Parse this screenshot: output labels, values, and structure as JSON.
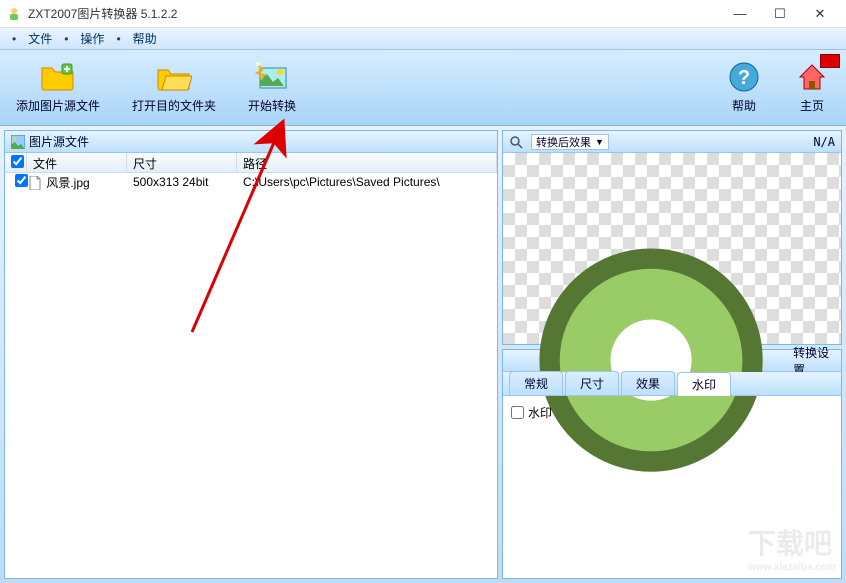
{
  "window": {
    "title": "ZXT2007图片转换器 5.1.2.2"
  },
  "menu": {
    "file": "文件",
    "operate": "操作",
    "help": "帮助"
  },
  "toolbar": {
    "add_source": "添加图片源文件",
    "open_dest": "打开目的文件夹",
    "start_convert": "开始转换",
    "help": "帮助",
    "home": "主页"
  },
  "source_panel": {
    "title": "图片源文件",
    "columns": {
      "file": "文件",
      "size": "尺寸",
      "path": "路径"
    },
    "rows": [
      {
        "checked": true,
        "name": "风景.jpg",
        "size": "500x313  24bit",
        "path": "C:\\Users\\pc\\Pictures\\Saved Pictures\\"
      }
    ]
  },
  "preview_panel": {
    "title": "转换后效果",
    "status": "N/A"
  },
  "settings_panel": {
    "title": "转换设置",
    "tabs": {
      "general": "常规",
      "size": "尺寸",
      "effect": "效果",
      "watermark": "水印"
    },
    "watermark_checkbox": "水印"
  },
  "watermark_brand": "下载吧",
  "watermark_url": "www.xiazaiba.com"
}
